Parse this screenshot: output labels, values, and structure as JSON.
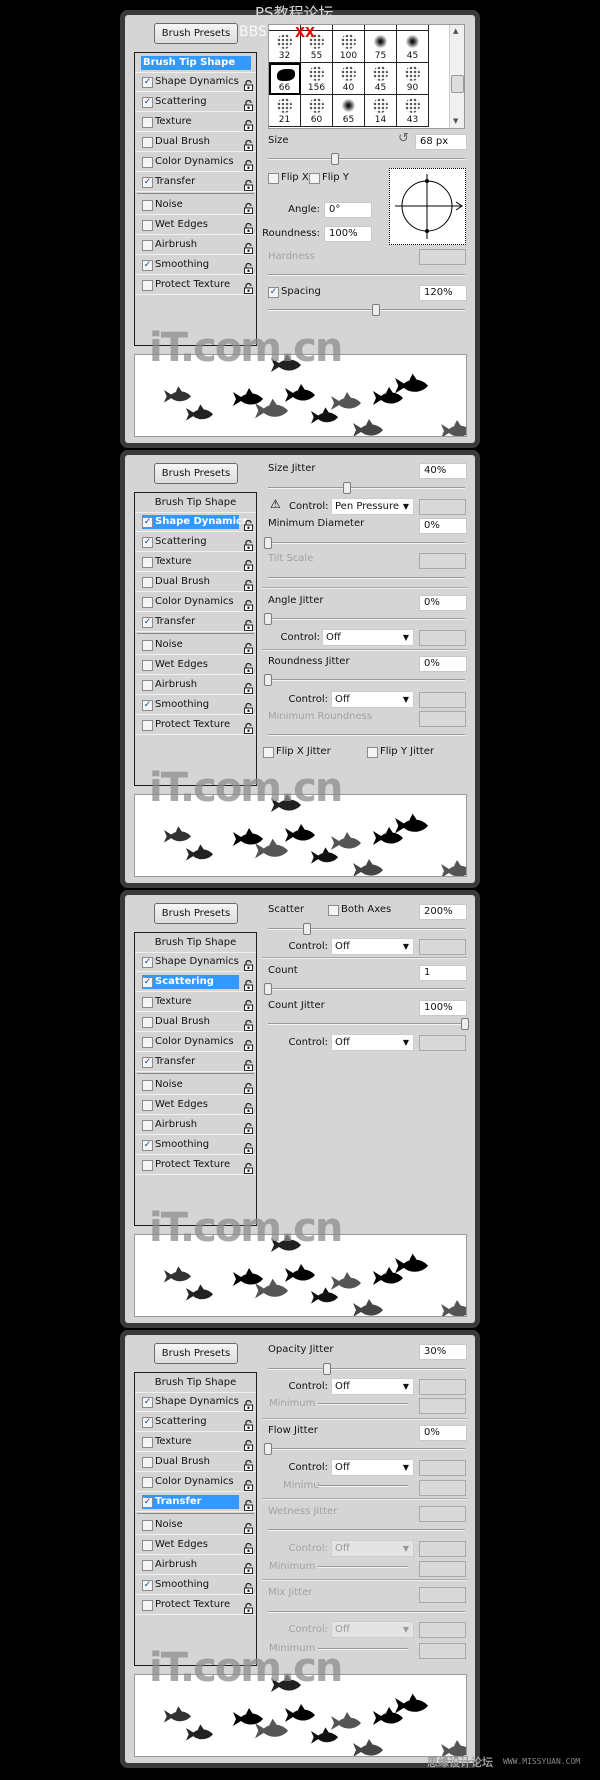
{
  "watermarks": {
    "top_title": "PS教程论坛",
    "top_bbs": "BBS",
    "top_xx": "XX",
    "logo": "iT.com.cn",
    "footer_cn": "思缘设计论坛",
    "footer_url": "WWW.MISSYUAN.COM"
  },
  "common": {
    "brush_presets_label": "Brush Presets",
    "brush_tip_shape_label": "Brush Tip Shape",
    "options_group1": [
      {
        "label": "Shape Dynamics",
        "checked": true
      },
      {
        "label": "Scattering",
        "checked": true
      },
      {
        "label": "Texture",
        "checked": false
      },
      {
        "label": "Dual Brush",
        "checked": false
      },
      {
        "label": "Color Dynamics",
        "checked": false
      },
      {
        "label": "Transfer",
        "checked": true
      }
    ],
    "options_group2": [
      {
        "label": "Noise",
        "checked": false
      },
      {
        "label": "Wet Edges",
        "checked": false
      },
      {
        "label": "Airbrush",
        "checked": false
      },
      {
        "label": "Smoothing",
        "checked": true
      },
      {
        "label": "Protect Texture",
        "checked": false
      }
    ],
    "highlight_color": "#3399ff"
  },
  "panels": [
    {
      "selected": "Brush Tip Shape",
      "brush_grid": {
        "rows": [
          [
            "32",
            "55",
            "100",
            "75",
            "45"
          ],
          [
            "66",
            "156",
            "40",
            "45",
            "90"
          ],
          [
            "21",
            "60",
            "65",
            "14",
            "43"
          ]
        ],
        "selected": "66"
      },
      "size": {
        "label": "Size",
        "value": "68 px",
        "slider": 0.34
      },
      "flip_x": {
        "label": "Flip X",
        "checked": false
      },
      "flip_y": {
        "label": "Flip Y",
        "checked": false
      },
      "angle": {
        "label": "Angle:",
        "value": "0°"
      },
      "roundness": {
        "label": "Roundness:",
        "value": "100%"
      },
      "hardness": {
        "label": "Hardness"
      },
      "spacing": {
        "label": "Spacing",
        "checked": true,
        "value": "120%",
        "slider": 0.55
      }
    },
    {
      "selected": "Shape Dynamics",
      "size_jitter": {
        "label": "Size Jitter",
        "value": "40%",
        "slider": 0.4
      },
      "size_control": {
        "label": "Control:",
        "value": "Pen Pressure"
      },
      "min_diameter": {
        "label": "Minimum Diameter",
        "value": "0%",
        "slider": 0
      },
      "tilt_scale": {
        "label": "Tilt Scale"
      },
      "angle_jitter": {
        "label": "Angle Jitter",
        "value": "0%",
        "slider": 0
      },
      "angle_control": {
        "label": "Control:",
        "value": "Off"
      },
      "roundness_jitter": {
        "label": "Roundness Jitter",
        "value": "0%",
        "slider": 0
      },
      "roundness_control": {
        "label": "Control:",
        "value": "Off"
      },
      "min_roundness": {
        "label": "Minimum Roundness"
      },
      "flip_x_jitter": {
        "label": "Flip X Jitter",
        "checked": false
      },
      "flip_y_jitter": {
        "label": "Flip Y Jitter",
        "checked": false
      }
    },
    {
      "selected": "Scattering",
      "scatter": {
        "label": "Scatter",
        "value": "200%",
        "slider": 0.2
      },
      "both_axes": {
        "label": "Both Axes",
        "checked": false
      },
      "scatter_control": {
        "label": "Control:",
        "value": "Off"
      },
      "count": {
        "label": "Count",
        "value": "1",
        "slider": 0
      },
      "count_jitter": {
        "label": "Count Jitter",
        "value": "100%",
        "slider": 1
      },
      "count_control": {
        "label": "Control:",
        "value": "Off"
      }
    },
    {
      "selected": "Transfer",
      "opacity_jitter": {
        "label": "Opacity Jitter",
        "value": "30%",
        "slider": 0.3
      },
      "opacity_control": {
        "label": "Control:",
        "value": "Off"
      },
      "opacity_minimum": {
        "label": "Minimum"
      },
      "flow_jitter": {
        "label": "Flow Jitter",
        "value": "0%",
        "slider": 0
      },
      "flow_control": {
        "label": "Control:",
        "value": "Off"
      },
      "flow_minimum": {
        "label": "Minimu"
      },
      "wetness_jitter": {
        "label": "Wetness Jitter"
      },
      "wetness_control": {
        "label": "Control:",
        "value": "Off"
      },
      "wetness_minimum": {
        "label": "Minimum"
      },
      "mix_jitter": {
        "label": "Mix Jitter"
      },
      "mix_control": {
        "label": "Control:",
        "value": "Off"
      },
      "mix_minimum": {
        "label": "Minimum"
      }
    }
  ]
}
